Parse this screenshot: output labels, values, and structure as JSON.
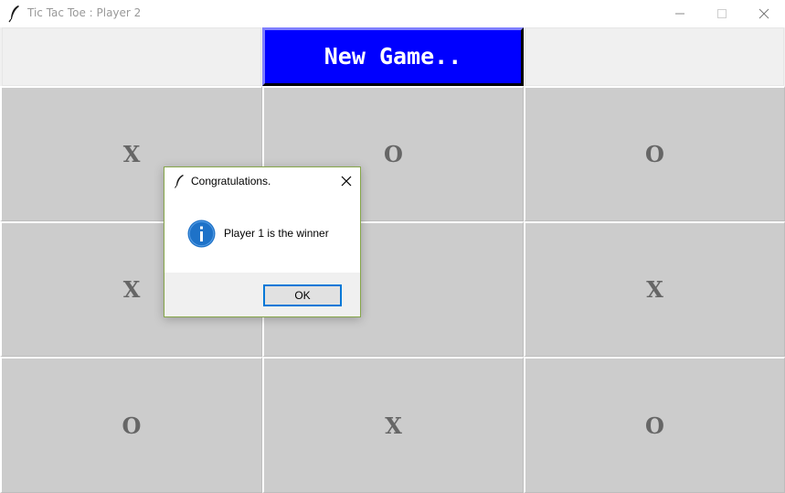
{
  "window": {
    "title": "Tic Tac Toe : Player 2",
    "app_icon": "feather-icon",
    "controls": [
      "minimize-icon",
      "maximize-icon",
      "close-icon"
    ]
  },
  "toolbar": {
    "new_game_label": "New Game..",
    "new_game_bg": "#0000ff",
    "new_game_text_color": "#ffffff"
  },
  "board": {
    "cell_bg": "#cccccc",
    "mark_color": "#666666",
    "cells": [
      "X",
      "O",
      "O",
      "X",
      "",
      "X",
      "O",
      "X",
      "O"
    ]
  },
  "dialog": {
    "title": "Congratulations.",
    "icon": "info-icon",
    "message": "Player 1 is the winner",
    "ok_label": "OK"
  }
}
